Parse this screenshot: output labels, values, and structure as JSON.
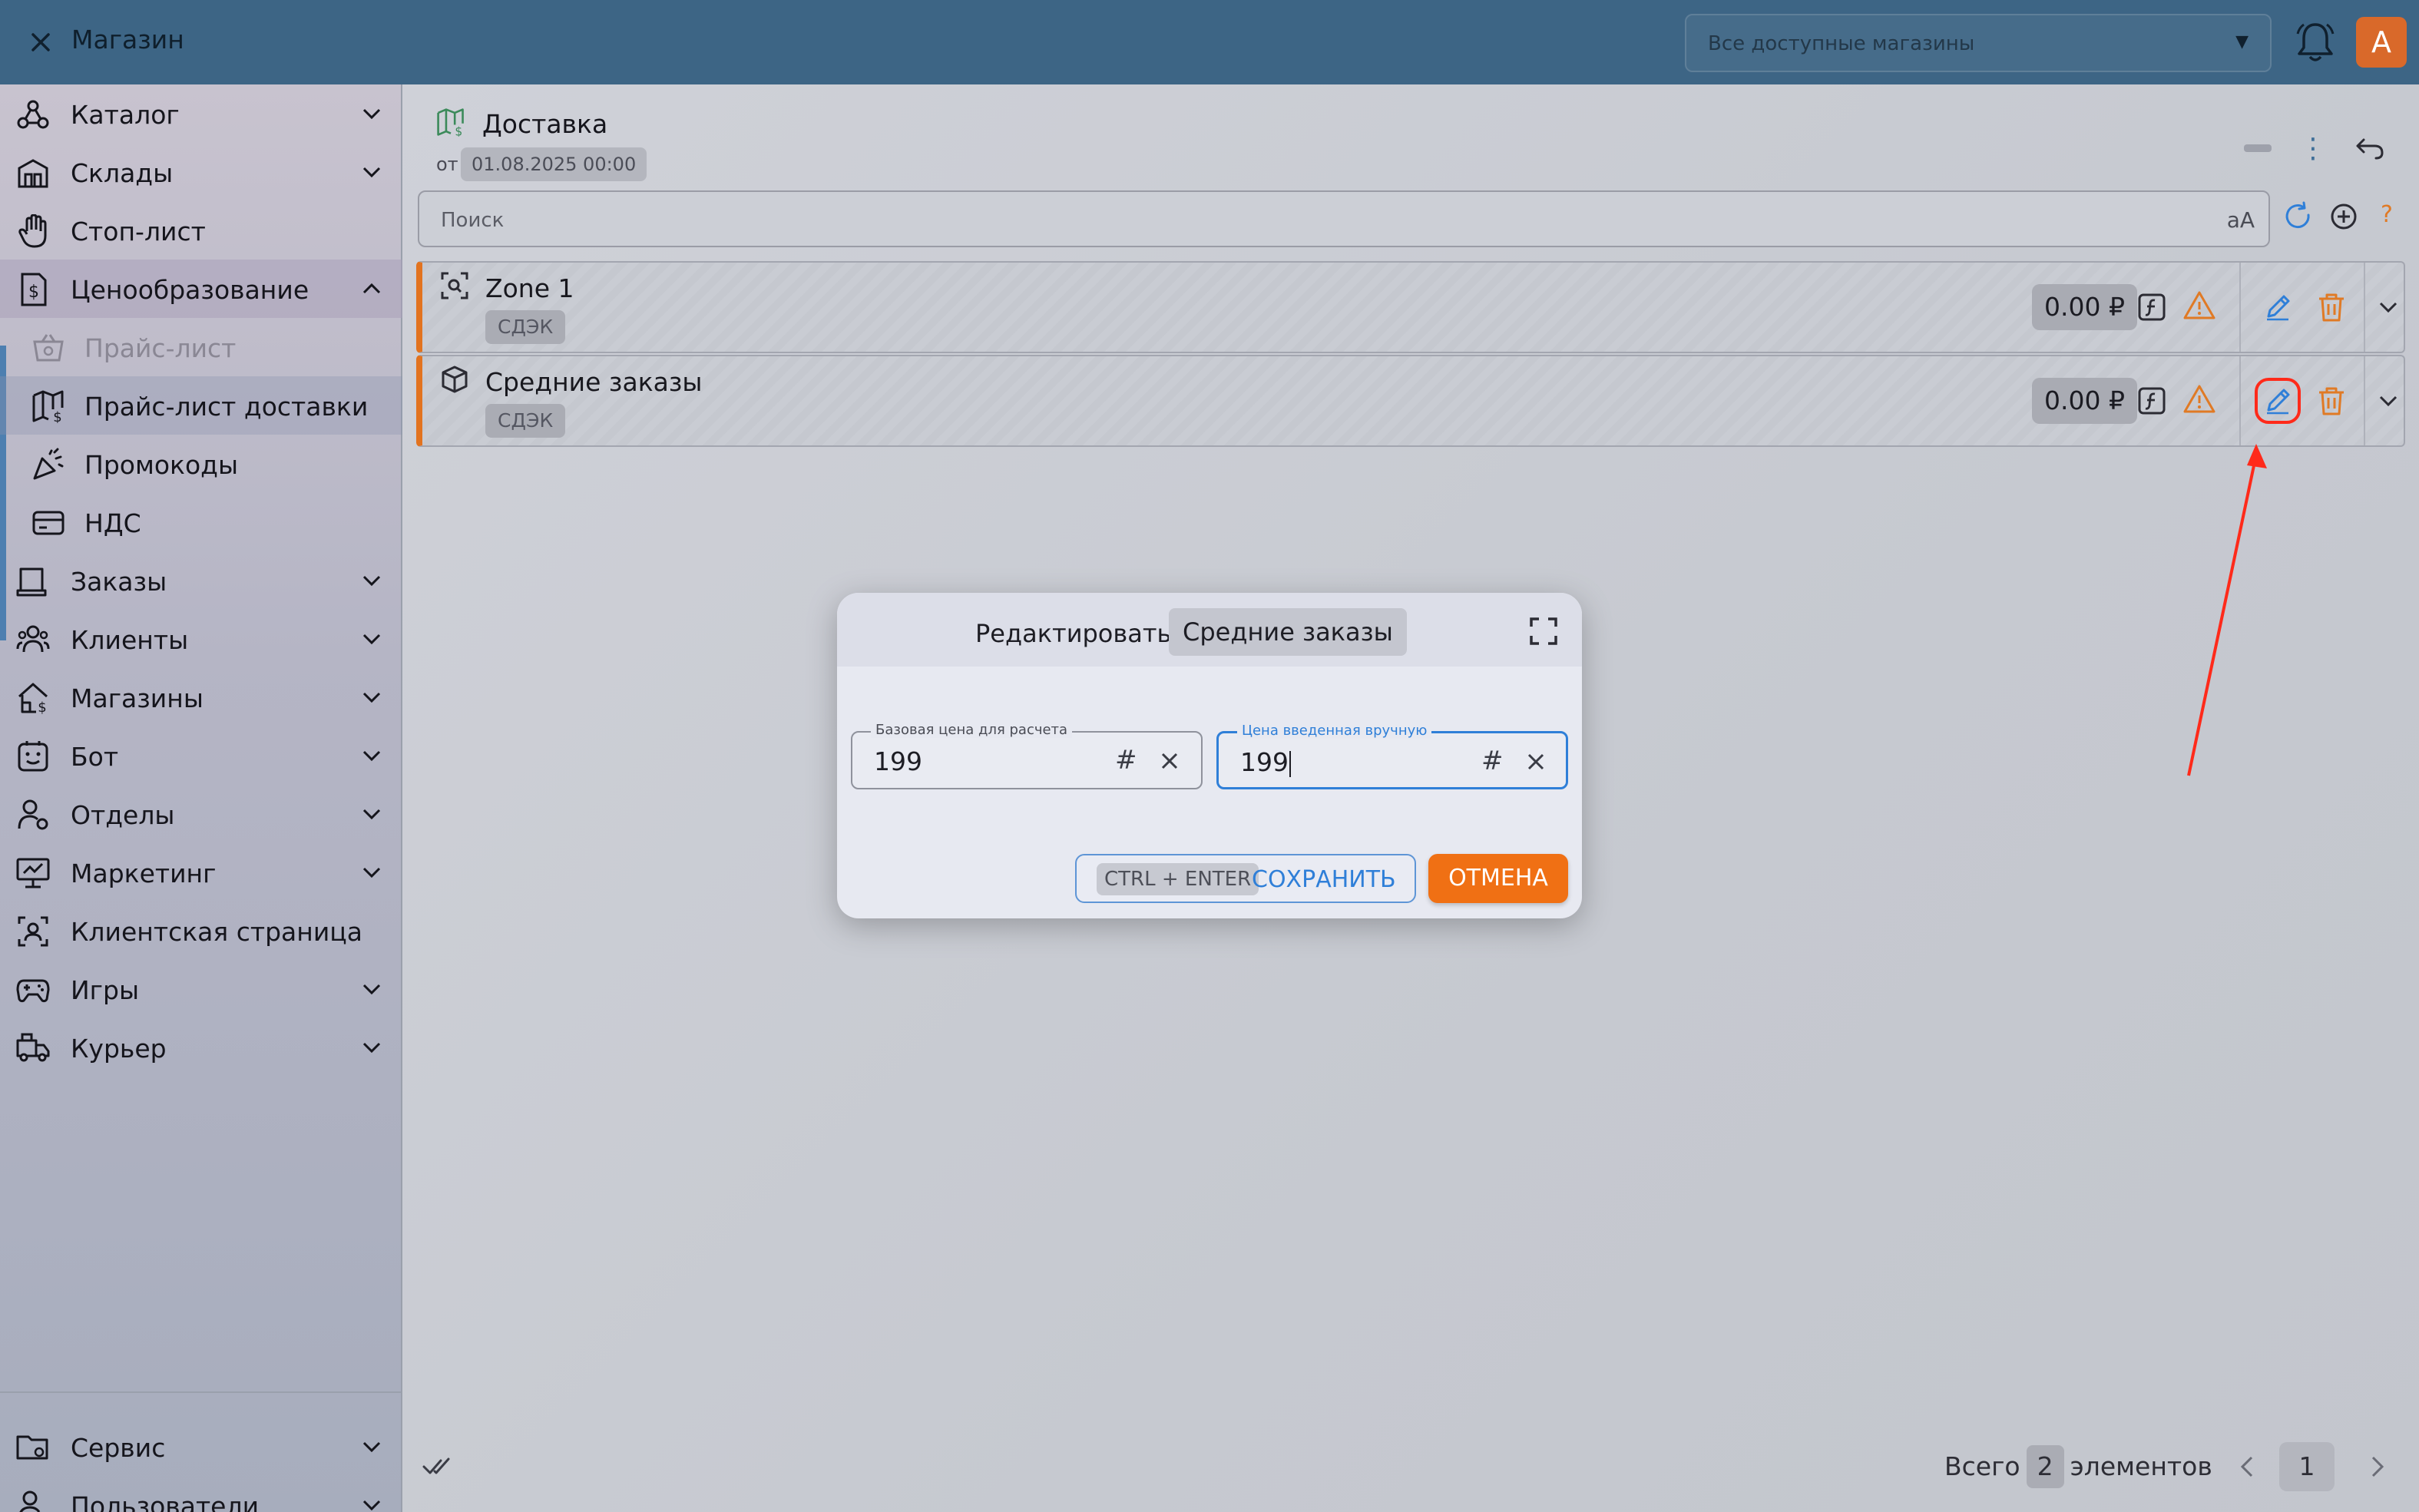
{
  "topbar": {
    "title": "Магазин",
    "shop_select": "Все доступные магазины",
    "avatar_letter": "A"
  },
  "sidebar": {
    "items": [
      {
        "label": "Каталог",
        "icon": "catalog-icon",
        "expandable": true
      },
      {
        "label": "Склады",
        "icon": "warehouse-icon",
        "expandable": true
      },
      {
        "label": "Стоп-лист",
        "icon": "hand-stop-icon",
        "expandable": false
      },
      {
        "label": "Ценообразование",
        "icon": "pricing-icon",
        "expandable": true,
        "expanded": true
      },
      {
        "label": "Прайс-лист",
        "icon": "price-basket-icon",
        "sub": true,
        "disabled": true
      },
      {
        "label": "Прайс-лист доставки",
        "icon": "delivery-map-icon",
        "sub": true,
        "selected": true
      },
      {
        "label": "Промокоды",
        "icon": "promo-icon",
        "sub": true
      },
      {
        "label": "НДС",
        "icon": "vat-card-icon",
        "sub": true
      },
      {
        "label": "Заказы",
        "icon": "orders-icon",
        "expandable": true
      },
      {
        "label": "Клиенты",
        "icon": "clients-icon",
        "expandable": true
      },
      {
        "label": "Магазины",
        "icon": "shops-icon",
        "expandable": true
      },
      {
        "label": "Бот",
        "icon": "bot-icon",
        "expandable": true
      },
      {
        "label": "Отделы",
        "icon": "departments-icon",
        "expandable": true
      },
      {
        "label": "Маркетинг",
        "icon": "marketing-icon",
        "expandable": true
      },
      {
        "label": "Клиентская страница",
        "icon": "client-page-icon",
        "expandable": false
      },
      {
        "label": "Игры",
        "icon": "gamepad-icon",
        "expandable": true
      },
      {
        "label": "Курьер",
        "icon": "courier-icon",
        "expandable": true
      }
    ],
    "bottom": [
      {
        "label": "Сервис",
        "icon": "service-folder-icon",
        "expandable": true
      },
      {
        "label": "Пользователи",
        "icon": "users-icon",
        "expandable": true
      }
    ]
  },
  "header": {
    "title": "Доставка",
    "from_label": "от",
    "date": "01.08.2025 00:00"
  },
  "search": {
    "placeholder": "Поиск",
    "case_toggle": "aA",
    "help": "?"
  },
  "rows": [
    {
      "title": "Zone 1",
      "tag": "СДЭК",
      "price": "0.00 ₽",
      "icon": "zone-scan-icon"
    },
    {
      "title": "Средние заказы",
      "tag": "СДЭК",
      "price": "0.00 ₽",
      "icon": "box-icon"
    }
  ],
  "footer": {
    "total_prefix": "Всего",
    "total_count": "2",
    "total_suffix": "элементов",
    "page": "1"
  },
  "modal": {
    "title": "Редактировать",
    "item_name": "Средние заказы",
    "field_base": {
      "label": "Базовая цена для расчета",
      "value": "199",
      "suffix": "#"
    },
    "field_manual": {
      "label": "Цена введенная вручную",
      "value": "199",
      "suffix": "#"
    },
    "save_shortcut": "CTRL + ENTER",
    "save_label": "СОХРАНИТЬ",
    "cancel_label": "ОТМЕНА"
  },
  "colors": {
    "topbar": "#3d6585",
    "accent_orange": "#f07014",
    "accent_blue": "#2f7fd8",
    "annotation_red": "#ff2a1a"
  }
}
